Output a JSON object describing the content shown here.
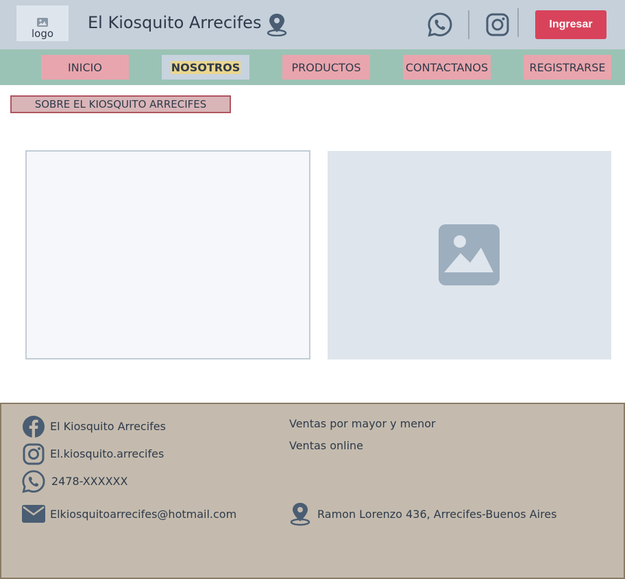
{
  "header": {
    "logo_text": "logo",
    "site_title": "El Kiosquito Arrecifes",
    "login_label": "Ingresar"
  },
  "nav": {
    "items": [
      {
        "label": "INICIO"
      },
      {
        "label": "NOSOTROS"
      },
      {
        "label": "PRODUCTOS"
      },
      {
        "label": "CONTACTANOS"
      },
      {
        "label": "REGISTRARSE"
      }
    ],
    "active": "NOSOTROS"
  },
  "main": {
    "section_label": "SOBRE EL KIOSQUITO ARRECIFES"
  },
  "footer": {
    "facebook": "El Kiosquito Arrecifes",
    "instagram": "El.kiosquito.arrecifes",
    "phone": "2478-XXXXXX",
    "email": "Elkiosquitoarrecifes@hotmail.com",
    "sales_1": "Ventas por mayor y menor",
    "sales_2": "Ventas online",
    "address": "Ramon Lorenzo 436, Arrecifes-Buenos Aires"
  },
  "colors": {
    "header_bg": "#c5d0da",
    "nav_bg": "#9ac3b5",
    "nav_item_bg": "#e9a5ad",
    "nav_active_bg": "#c7d3de",
    "accent": "#d8435b",
    "footer_bg": "#c4bbae",
    "icon_color": "#4a5d73"
  },
  "icons": {
    "location": "location-pin-icon",
    "whatsapp": "whatsapp-icon",
    "instagram": "instagram-icon",
    "facebook": "facebook-icon",
    "email": "envelope-icon",
    "image_placeholder": "image-placeholder-icon"
  }
}
